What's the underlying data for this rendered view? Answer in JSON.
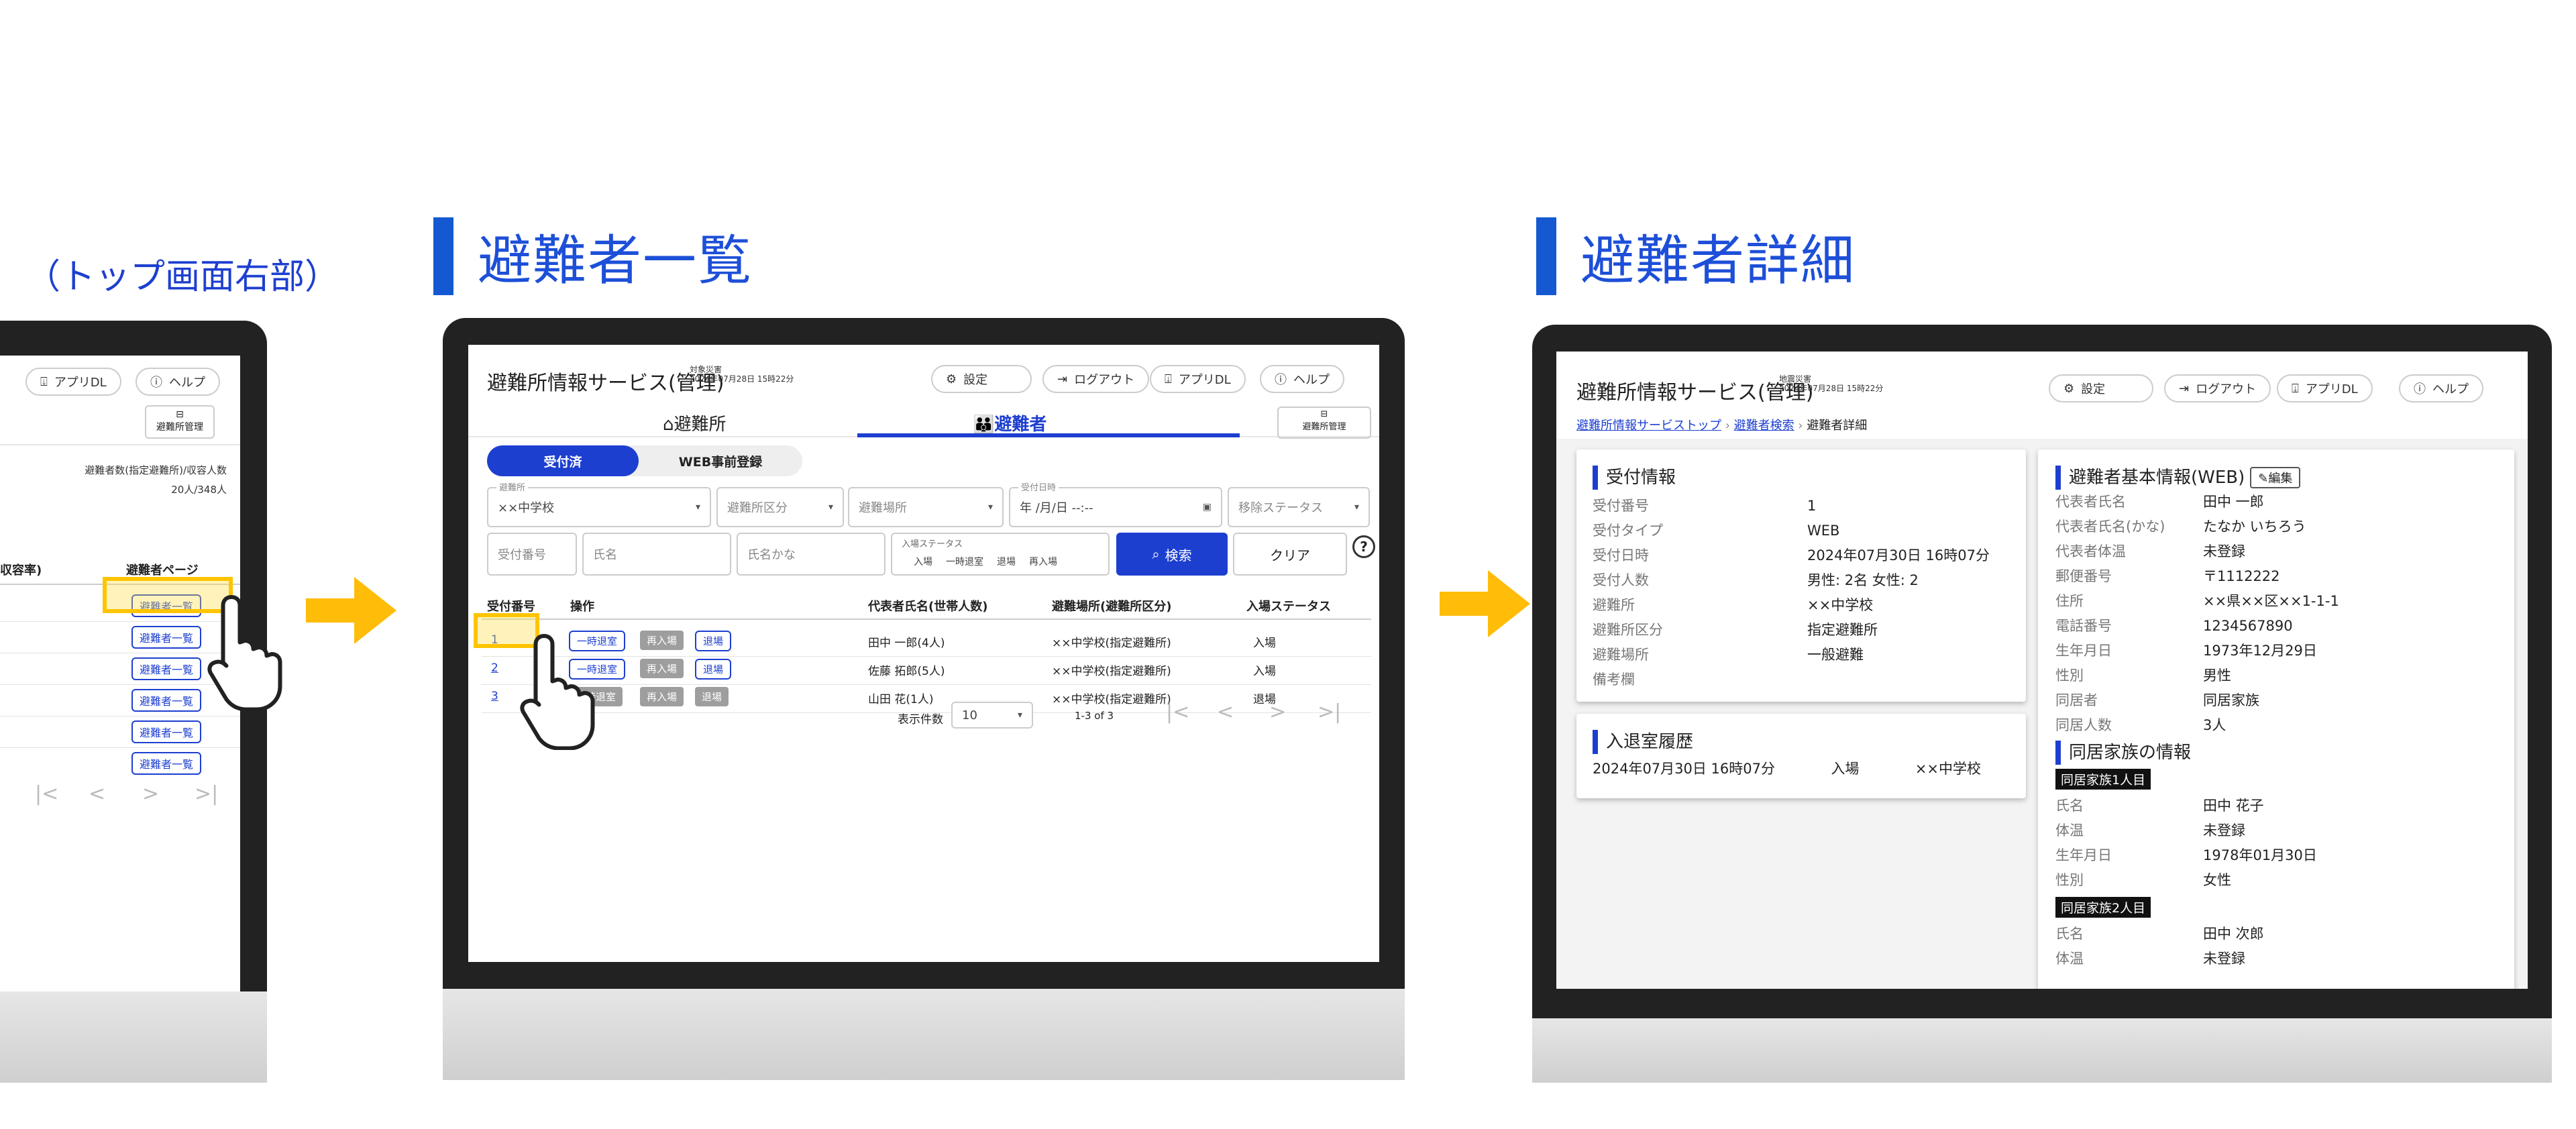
{
  "left": {
    "caption": "（トップ画面右部）",
    "header_buttons": [
      "アプリDL",
      "ヘルプ"
    ],
    "manage_label": "避難所管理",
    "counts_label": "避難者数(指定避難所)/収容人数",
    "counts_value": "20人/348人",
    "col_left": "収容率)",
    "col_right": "避難者ページ",
    "row_left": ")",
    "row_button": "避難者一覧"
  },
  "middle": {
    "section_title": "避難者一覧",
    "app_title": "避難所情報サービス(管理)",
    "disaster_name": "対象災害",
    "date_time": "2024年07月28日 15時22分",
    "header_buttons": {
      "settings": "設定",
      "logout": "ログアウト",
      "appdl": "アプリDL",
      "help": "ヘルプ"
    },
    "tabs": {
      "shelter": "避難所",
      "evacuee": "避難者",
      "manage": "避難所管理"
    },
    "subtabs": {
      "reception": "受付済",
      "web": "WEB事前登録"
    },
    "filters": {
      "shelter_label": "避難所",
      "shelter_value": "××中学校",
      "category": "避難所区分",
      "place": "避難場所",
      "datetime_label": "受付日時",
      "datetime_value": "年 /月/日 --:--",
      "status": "移除ステータス",
      "number": "受付番号",
      "name": "氏名",
      "kana": "氏名かな",
      "entry_label": "入場ステータス",
      "entry_options": [
        "入場",
        "一時退室",
        "退場",
        "再入場"
      ],
      "search": "検索",
      "clear": "クリア"
    },
    "table": {
      "headers": [
        "受付番号",
        "操作",
        "代表者氏名(世帯人数)",
        "避難場所(避難所区分)",
        "入場ステータス"
      ],
      "action_labels": [
        "一時退室",
        "再入場",
        "退場"
      ],
      "rows": [
        {
          "no": "1",
          "name": "田中 一郎(4人)",
          "place": "××中学校(指定避難所)",
          "status": "入場"
        },
        {
          "no": "2",
          "name": "佐藤 拓郎(5人)",
          "place": "××中学校(指定避難所)",
          "status": "入場"
        },
        {
          "no": "3",
          "name": "山田 花(1人)",
          "place": "××中学校(指定避難所)",
          "status": "退場"
        }
      ]
    },
    "pager": {
      "label": "表示件数",
      "size": "10",
      "range": "1-3 of 3"
    }
  },
  "right": {
    "section_title": "避難者詳細",
    "app_title": "避難所情報サービス(管理)",
    "disaster_name": "地震災害",
    "date_time": "2024年07月28日 15時22分",
    "header_buttons": {
      "settings": "設定",
      "logout": "ログアウト",
      "appdl": "アプリDL",
      "help": "ヘルプ"
    },
    "breadcrumb": {
      "top": "避難所情報サービストップ",
      "search": "避難者検索",
      "current": "避難者詳細"
    },
    "reception": {
      "title": "受付情報",
      "rows": [
        {
          "k": "受付番号",
          "v": "1"
        },
        {
          "k": "受付タイプ",
          "v": "WEB"
        },
        {
          "k": "受付日時",
          "v": "2024年07月30日 16時07分"
        },
        {
          "k": "受付人数",
          "v": "男性: 2名 女性: 2"
        },
        {
          "k": "避難所",
          "v": "××中学校"
        },
        {
          "k": "避難所区分",
          "v": "指定避難所"
        },
        {
          "k": "避難場所",
          "v": "一般避難"
        },
        {
          "k": "備考欄",
          "v": ""
        }
      ]
    },
    "history": {
      "title": "入退室履歴",
      "date": "2024年07月30日 16時07分",
      "status": "入場",
      "place": "××中学校"
    },
    "basic": {
      "title": "避難者基本情報(WEB)",
      "edit": "編集",
      "rows": [
        {
          "k": "代表者氏名",
          "v": "田中 一郎"
        },
        {
          "k": "代表者氏名(かな)",
          "v": "たなか いちろう"
        },
        {
          "k": "代表者体温",
          "v": "未登録"
        },
        {
          "k": "郵便番号",
          "v": "〒1112222"
        },
        {
          "k": "住所",
          "v": "××県××区××1-1-1"
        },
        {
          "k": "電話番号",
          "v": "1234567890"
        },
        {
          "k": "生年月日",
          "v": "1973年12月29日"
        },
        {
          "k": "性別",
          "v": "男性"
        },
        {
          "k": "同居者",
          "v": "同居家族"
        },
        {
          "k": "同居人数",
          "v": "3人"
        }
      ],
      "family_title": "同居家族の情報",
      "member1": {
        "tag": "同居家族1人目",
        "rows": [
          {
            "k": "氏名",
            "v": "田中 花子"
          },
          {
            "k": "体温",
            "v": "未登録"
          },
          {
            "k": "生年月日",
            "v": "1978年01月30日"
          },
          {
            "k": "性別",
            "v": "女性"
          }
        ]
      },
      "member2": {
        "tag": "同居家族2人目",
        "rows": [
          {
            "k": "氏名",
            "v": "田中 次郎"
          },
          {
            "k": "体温",
            "v": "未登録"
          }
        ]
      }
    }
  }
}
